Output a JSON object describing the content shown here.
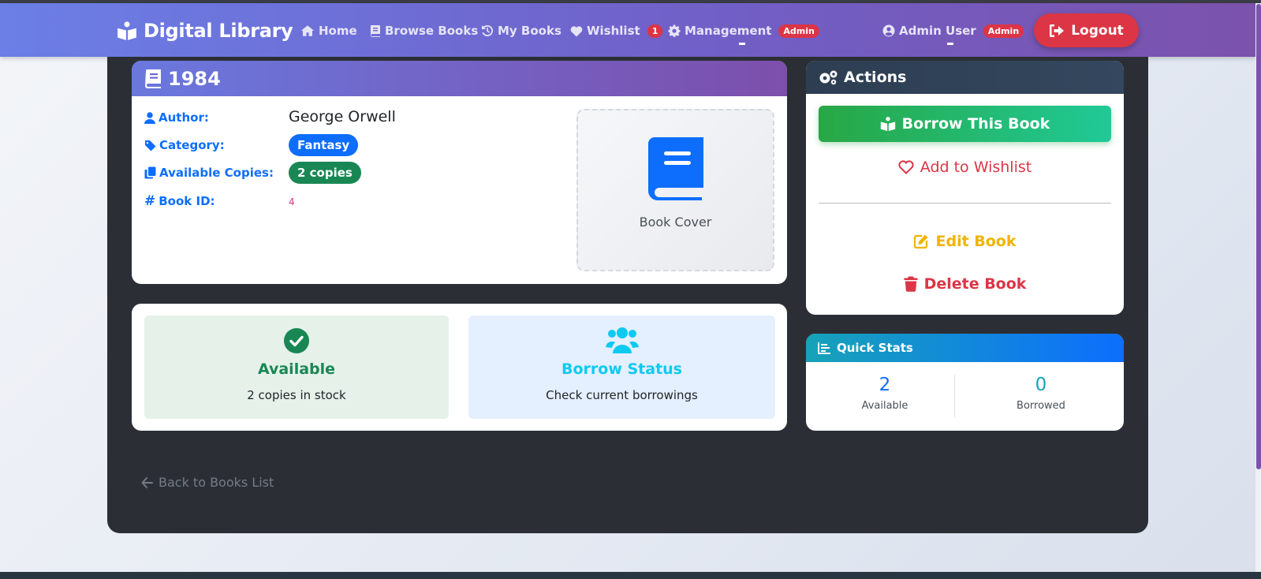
{
  "nav": {
    "brand": "Digital Library",
    "home": "Home",
    "browse": "Browse Books",
    "my_books": "My Books",
    "wishlist": "Wishlist",
    "wishlist_count": "1",
    "management": "Management",
    "management_badge": "Admin",
    "user": "Admin User",
    "user_badge": "Admin",
    "logout": "Logout"
  },
  "book": {
    "title": "1984",
    "author_label": "Author:",
    "author": "George Orwell",
    "category_label": "Category:",
    "category": "Fantasy",
    "copies_label": "Available Copies:",
    "copies": "2 copies",
    "id_label": "Book ID:",
    "id": "4",
    "cover_label": "Book Cover"
  },
  "status": {
    "available_title": "Available",
    "available_sub": "2 copies in stock",
    "borrow_title": "Borrow Status",
    "borrow_sub": "Check current borrowings"
  },
  "actions": {
    "title": "Actions",
    "borrow": "Borrow This Book",
    "wishlist": "Add to Wishlist",
    "edit": "Edit Book",
    "delete": "Delete Book"
  },
  "quick_stats": {
    "title": "Quick Stats",
    "available_value": "2",
    "available_label": "Available",
    "borrowed_value": "0",
    "borrowed_label": "Borrowed"
  },
  "back_link": "Back to Books List",
  "colors": {
    "primary": "#0d6efd",
    "success": "#198754",
    "danger": "#dc3545",
    "warning": "#f0b400",
    "info": "#17a2b8"
  }
}
